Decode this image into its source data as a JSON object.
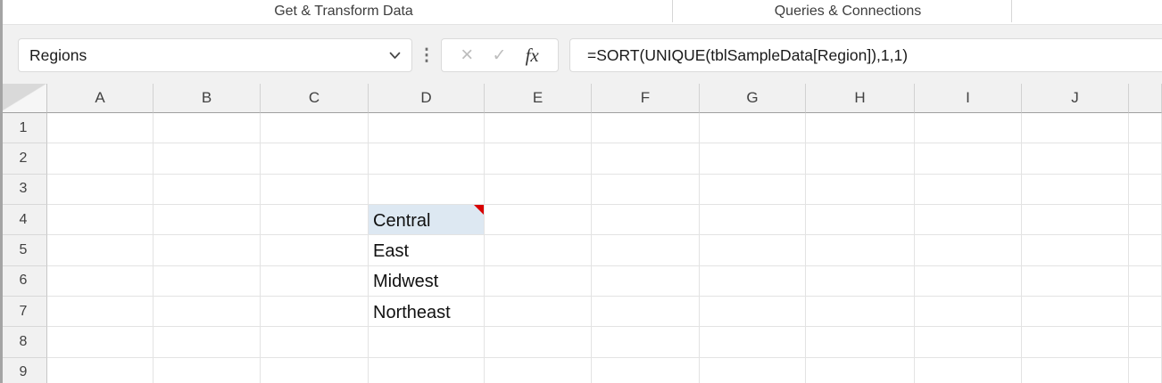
{
  "ribbon": {
    "groups": [
      {
        "label": "Get & Transform Data"
      },
      {
        "label": "Queries & Connections"
      }
    ]
  },
  "formula_bar": {
    "name_box": {
      "value": "Regions"
    },
    "icons": {
      "vertical_dots": "⋮",
      "cancel": "×",
      "enter": "✓",
      "insert_function": "fx"
    },
    "formula": "=SORT(UNIQUE(tblSampleData[Region]),1,1)"
  },
  "grid": {
    "column_headers": [
      "A",
      "B",
      "C",
      "D",
      "E",
      "F",
      "G",
      "H",
      "I",
      "J",
      ""
    ],
    "row_headers": [
      "1",
      "2",
      "3",
      "4",
      "5",
      "6",
      "7",
      "8",
      "9"
    ],
    "cells": [
      {
        "row": "4",
        "col": "D",
        "value": "Central",
        "selected": true,
        "comment_indicator": true
      },
      {
        "row": "5",
        "col": "D",
        "value": "East"
      },
      {
        "row": "6",
        "col": "D",
        "value": "Midwest"
      },
      {
        "row": "7",
        "col": "D",
        "value": "Northeast"
      }
    ],
    "colors": {
      "selection_fill": "#dde8f2",
      "comment_indicator": "#d80000"
    }
  }
}
